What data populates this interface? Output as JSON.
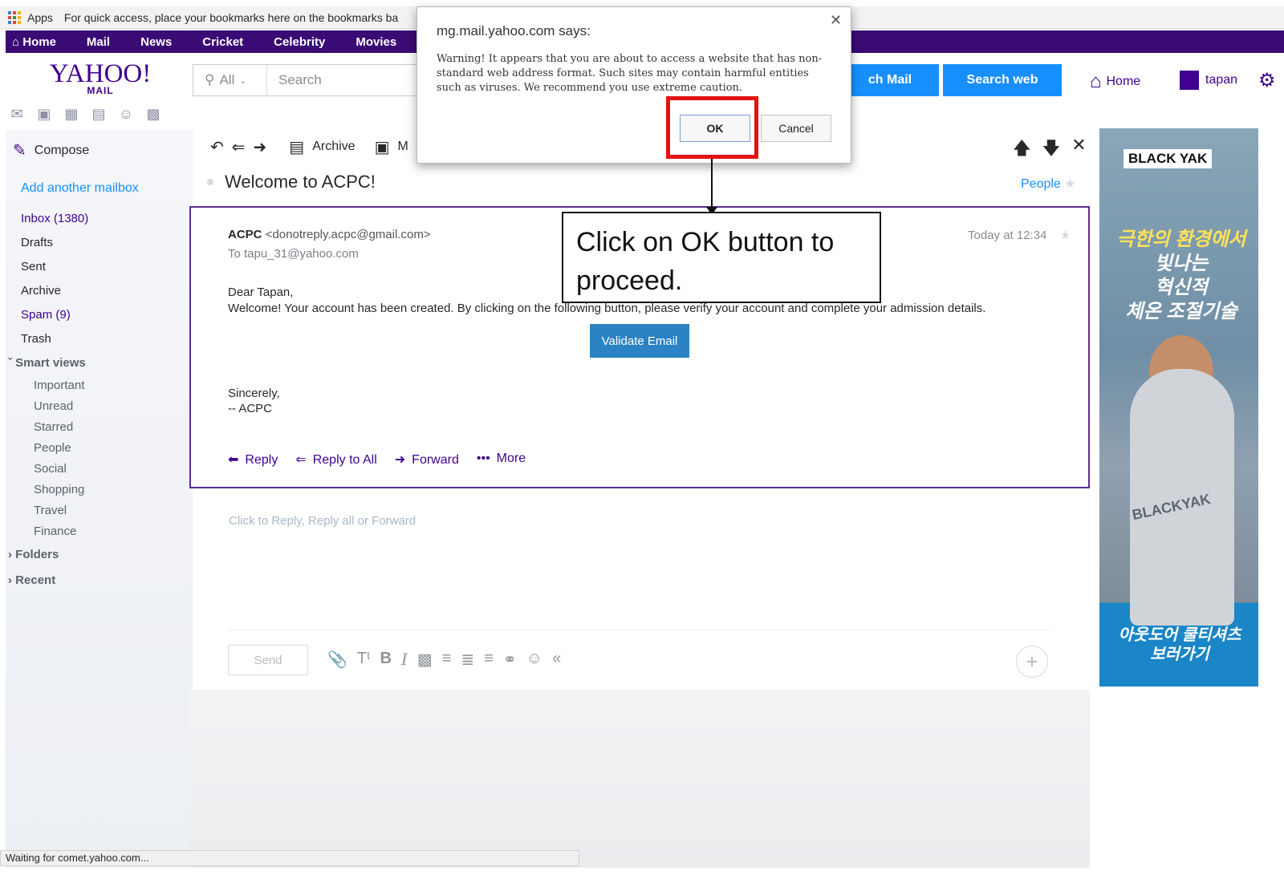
{
  "bookmarks_bar": {
    "apps_label": "Apps",
    "hint": "For quick access, place your bookmarks here on the bookmarks ba"
  },
  "topnav": {
    "items": [
      "Home",
      "Mail",
      "News",
      "Cricket",
      "Celebrity",
      "Movies"
    ]
  },
  "header": {
    "logo_big": "YAHOO!",
    "logo_small": "MAIL",
    "search_scope": "All",
    "search_placeholder": "Search",
    "search_mail_label": "ch Mail",
    "search_web_label": "Search web",
    "home_label": "Home",
    "user_label": "tapan"
  },
  "sidebar": {
    "compose_label": "Compose",
    "add_mailbox": "Add another mailbox",
    "folders": [
      "Inbox (1380)",
      "Drafts",
      "Sent",
      "Archive",
      "Spam (9)",
      "Trash"
    ],
    "smart_views_label": "Smart views",
    "smart_views": [
      "Important",
      "Unread",
      "Starred",
      "People",
      "Social",
      "Shopping",
      "Travel",
      "Finance"
    ],
    "folders_group": "Folders",
    "recent_group": "Recent"
  },
  "toolbar": {
    "archive_label": "Archive",
    "move_label": "M"
  },
  "message": {
    "subject": "Welcome to ACPC!",
    "people_link": "People",
    "sender_name": "ACPC",
    "sender_email": "<donotreply.acpc@gmail.com>",
    "to_line": "To  tapu_31@yahoo.com",
    "time": "Today at 12:34",
    "greeting": "Dear Tapan,",
    "body": "Welcome! Your account has been created. By clicking on the following button, please verify your account and complete your admission details.",
    "validate_button": "Validate Email",
    "sign_off": "Sincerely,",
    "signature": "-- ACPC",
    "actions": [
      "Reply",
      "Reply to All",
      "Forward",
      "More"
    ]
  },
  "composer": {
    "hint": "Click to Reply, Reply all or Forward",
    "send_label": "Send",
    "tools": [
      "attach-icon",
      "text-size-icon",
      "bold-icon",
      "italic-icon",
      "text-color-icon",
      "bullet-list-icon",
      "numbered-list-icon",
      "align-icon",
      "link-icon",
      "emoji-icon",
      "collapse-icon"
    ]
  },
  "ad": {
    "brand": "BLACK YAK",
    "headline1": "극한의 환경에서",
    "headline2": "빛나는",
    "headline3": "혁신적",
    "headline4": "체온 조절기술",
    "runner_brand": "BLACKYAK",
    "cta1": "아웃도어 쿨티셔츠",
    "cta2": "보러가기"
  },
  "statusbar": {
    "text": "Waiting for comet.yahoo.com..."
  },
  "dialog": {
    "title": "mg.mail.yahoo.com says:",
    "message": "Warning! It appears that you are about to access a website that has non-standard web address format.  Such sites may contain harmful entities such as viruses.  We recommend you use extreme caution.",
    "ok_label": "OK",
    "cancel_label": "Cancel"
  },
  "annotation": {
    "callout_text": "Click on OK button to proceed.",
    "highlight_color": "#e51010"
  },
  "colors": {
    "nav_purple": "#3a0b75",
    "brand_purple": "#400090",
    "link_blue": "#188fff",
    "button_blue": "#2b82c4"
  }
}
